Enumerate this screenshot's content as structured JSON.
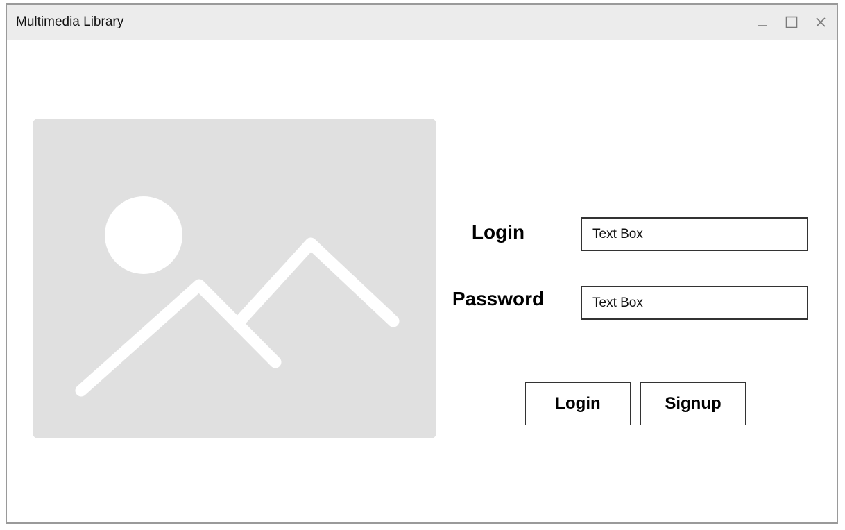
{
  "window": {
    "title": "Multimedia Library",
    "controls": {
      "minimize": "minimize-icon",
      "maximize": "maximize-icon",
      "close": "close-icon"
    }
  },
  "form": {
    "login_label": "Login",
    "login_value": "Text Box",
    "password_label": "Password",
    "password_value": "Text Box"
  },
  "buttons": {
    "login": "Login",
    "signup": "Signup"
  },
  "image": {
    "icon": "image-placeholder-icon"
  },
  "colors": {
    "titlebar_bg": "#ececec",
    "placeholder_bg": "#e0e0e0",
    "border": "#333333"
  }
}
